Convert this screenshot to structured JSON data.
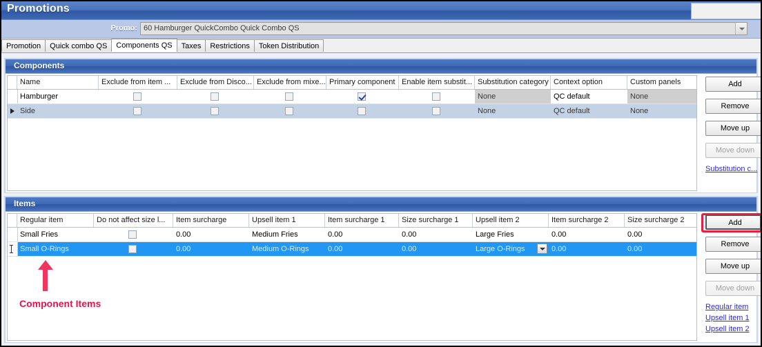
{
  "window": {
    "title": "Promotions"
  },
  "promo": {
    "label": "Promo:",
    "value": "60 Hamburger QuickCombo Quick Combo QS",
    "placeholder": ""
  },
  "tabs": [
    {
      "label": "Promotion",
      "active": false
    },
    {
      "label": "Quick combo QS",
      "active": false
    },
    {
      "label": "Components QS",
      "active": true
    },
    {
      "label": "Taxes",
      "active": false
    },
    {
      "label": "Restrictions",
      "active": false
    },
    {
      "label": "Token Distribution",
      "active": false
    }
  ],
  "components_panel": {
    "title": "Components",
    "columns": [
      "Name",
      "Exclude from item ...",
      "Exclude from Disco...",
      "Exclude from mixe...",
      "Primary component",
      "Enable item substit...",
      "Substitution category",
      "Context option",
      "Custom panels"
    ],
    "rows": [
      {
        "name": "Hamburger",
        "exclude_from_item": false,
        "exclude_from_discount": false,
        "exclude_from_mixed": false,
        "primary_component": true,
        "enable_item_substitution": false,
        "substitution_category": "None",
        "context_option": "QC default",
        "custom_panels": "None",
        "selected": false,
        "current": false
      },
      {
        "name": "Side",
        "exclude_from_item": false,
        "exclude_from_discount": false,
        "exclude_from_mixed": false,
        "primary_component": false,
        "enable_item_substitution": false,
        "substitution_category": "None",
        "context_option": "QC default",
        "custom_panels": "None",
        "selected": true,
        "current": true
      }
    ],
    "buttons": [
      {
        "label": "Add",
        "disabled": false
      },
      {
        "label": "Remove",
        "disabled": false
      },
      {
        "label": "Move up",
        "disabled": false
      },
      {
        "label": "Move down",
        "disabled": true
      }
    ],
    "links": [
      "Substitution c..."
    ]
  },
  "items_panel": {
    "title": "Items",
    "columns": [
      "Regular item",
      "Do not affect size l...",
      "Item surcharge",
      "Upsell item 1",
      "Item surcharge 1",
      "Size surcharge 1",
      "Upsell item 2",
      "Item surcharge 2",
      "Size surcharge 2"
    ],
    "rows": [
      {
        "regular_item": "Small Fries",
        "do_not_affect_size": false,
        "item_surcharge": "0.00",
        "upsell_item_1": "Medium Fries",
        "item_surcharge_1": "0.00",
        "size_surcharge_1": "0.00",
        "upsell_item_2": "Large Fries",
        "item_surcharge_2": "0.00",
        "size_surcharge_2": "0.00",
        "selected": false,
        "editing": false
      },
      {
        "regular_item": "Small O-Rings",
        "do_not_affect_size": false,
        "item_surcharge": "0.00",
        "upsell_item_1": "Medium O-Rings",
        "item_surcharge_1": "0.00",
        "size_surcharge_1": "0.00",
        "upsell_item_2": "Large O-Rings",
        "item_surcharge_2": "0.00",
        "size_surcharge_2": "0.00",
        "selected": true,
        "editing": true
      }
    ],
    "buttons": [
      {
        "label": "Add",
        "disabled": false,
        "highlighted": true
      },
      {
        "label": "Remove",
        "disabled": false,
        "highlighted": false
      },
      {
        "label": "Move up",
        "disabled": false,
        "highlighted": false
      },
      {
        "label": "Move down",
        "disabled": true,
        "highlighted": false
      }
    ],
    "links": [
      "Regular item",
      "Upsell item 1",
      "Upsell item 2"
    ]
  },
  "annotation": {
    "text": "Component Items",
    "color": "#e8134a"
  },
  "colors": {
    "titlebar": "#3f68b4",
    "panel_header": "#3f6ab6",
    "selection": "#2196f3",
    "alt_row": "#c4d2e6",
    "annotation": "#e8134a",
    "link": "#2a2adf"
  }
}
